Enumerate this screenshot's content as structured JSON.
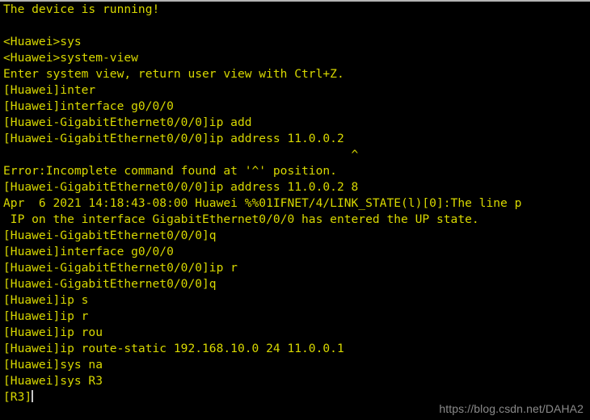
{
  "window": {
    "title": "Huawei eNSP CLI Terminal",
    "background_color": "#000000",
    "text_color": "#d8d800",
    "top_border_color": "#b4b4b4"
  },
  "terminal": {
    "prompt_device_initial": "Huawei",
    "prompt_device_final": "R3",
    "cursor_visible": true,
    "lines": [
      "The device is running!",
      "",
      "<Huawei>sys",
      "<Huawei>system-view",
      "Enter system view, return user view with Ctrl+Z.",
      "[Huawei]inter",
      "[Huawei]interface g0/0/0",
      "[Huawei-GigabitEthernet0/0/0]ip add",
      "[Huawei-GigabitEthernet0/0/0]ip address 11.0.0.2",
      "                                                 ^",
      "Error:Incomplete command found at '^' position.",
      "[Huawei-GigabitEthernet0/0/0]ip address 11.0.0.2 8",
      "Apr  6 2021 14:18:43-08:00 Huawei %%01IFNET/4/LINK_STATE(l)[0]:The line p",
      " IP on the interface GigabitEthernet0/0/0 has entered the UP state.",
      "[Huawei-GigabitEthernet0/0/0]q",
      "[Huawei]interface g0/0/0",
      "[Huawei-GigabitEthernet0/0/0]ip r",
      "[Huawei-GigabitEthernet0/0/0]q",
      "[Huawei]ip s",
      "[Huawei]ip r",
      "[Huawei]ip rou",
      "[Huawei]ip route-static 192.168.10.0 24 11.0.0.1",
      "[Huawei]sys na",
      "[Huawei]sys R3",
      "[R3]"
    ]
  },
  "watermark": {
    "text": "https://blog.csdn.net/DAHA2",
    "color": "#8a8a8a"
  }
}
